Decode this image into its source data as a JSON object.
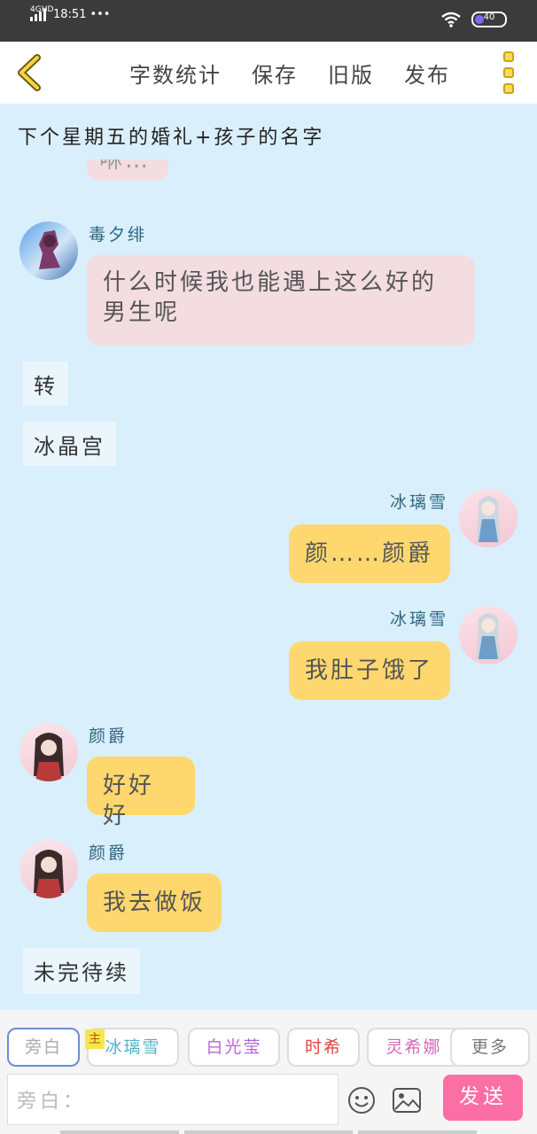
{
  "status": {
    "network": "4GHD",
    "time": "18:51",
    "dots": "•••",
    "battery": "40"
  },
  "header": {
    "nav": [
      "字数统计",
      "保存",
      "旧版",
      "发布"
    ]
  },
  "title": "下个星期五的婚礼+孩子的名字",
  "messages": {
    "partial": "咻…",
    "m1_name": "毒夕绯",
    "m1_text_line1": "什么时候我也能遇上这么好的",
    "m1_text_line2": "男生呢",
    "n1": "转",
    "n2": "冰晶宫",
    "m2_name": "冰璃雪",
    "m2_text": "颜……颜爵",
    "m3_name": "冰璃雪",
    "m3_text": "我肚子饿了",
    "m4_name": "颜爵",
    "m4_text": "好好好",
    "m5_name": "颜爵",
    "m5_text": "我去做饭",
    "n3": "未完待续"
  },
  "bottom": {
    "chips": [
      {
        "label": "旁白",
        "color": "#999999"
      },
      {
        "label": "冰璃雪",
        "color": "#4fb3c8"
      },
      {
        "label": "白光莹",
        "color": "#b36bd6"
      },
      {
        "label": "时希",
        "color": "#e0473f"
      },
      {
        "label": "灵希娜",
        "color": "#d86ab8"
      },
      {
        "label": "更多",
        "color": "#777777"
      }
    ],
    "main_tag": "主",
    "input_placeholder": "旁白：",
    "send": "发送"
  },
  "colors": {
    "accent_yellow": "#fed86e",
    "pink_bubble": "#f3dde0",
    "send": "#fc6fa4",
    "bg": "#d9effc"
  }
}
